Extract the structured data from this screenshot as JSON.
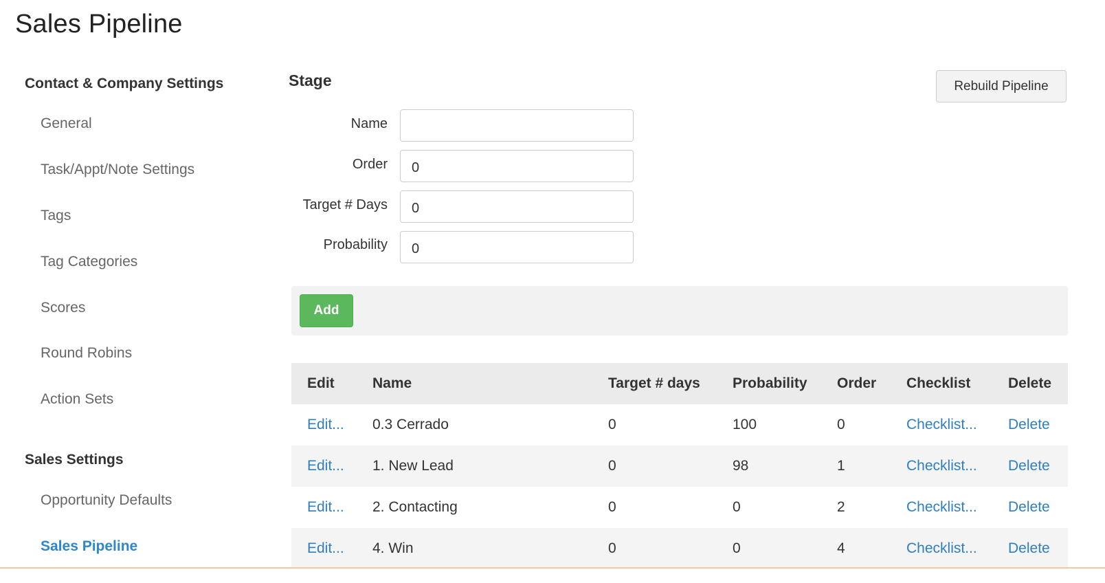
{
  "page": {
    "title": "Sales Pipeline"
  },
  "sidebar": {
    "contact_heading": "Contact & Company Settings",
    "contact_items": [
      {
        "label": "General"
      },
      {
        "label": "Task/Appt/Note Settings"
      },
      {
        "label": "Tags"
      },
      {
        "label": "Tag Categories"
      },
      {
        "label": "Scores"
      },
      {
        "label": "Round Robins"
      },
      {
        "label": "Action Sets"
      }
    ],
    "sales_heading": "Sales Settings",
    "sales_items": [
      {
        "label": "Opportunity Defaults"
      },
      {
        "label": "Sales Pipeline",
        "active": true
      }
    ]
  },
  "stage_form": {
    "heading": "Stage",
    "rebuild_label": "Rebuild Pipeline",
    "fields": {
      "name": {
        "label": "Name",
        "value": ""
      },
      "order": {
        "label": "Order",
        "value": "0"
      },
      "target_days": {
        "label": "Target # Days",
        "value": "0"
      },
      "probability": {
        "label": "Probability",
        "value": "0"
      }
    },
    "add_label": "Add"
  },
  "table": {
    "headers": {
      "edit": "Edit",
      "name": "Name",
      "target_days": "Target # days",
      "probability": "Probability",
      "order": "Order",
      "checklist": "Checklist",
      "delete": "Delete"
    },
    "rows": [
      {
        "edit": "Edit...",
        "name": "0.3 Cerrado",
        "target_days": "0",
        "probability": "100",
        "order": "0",
        "checklist": "Checklist...",
        "delete": "Delete"
      },
      {
        "edit": "Edit...",
        "name": "1. New Lead",
        "target_days": "0",
        "probability": "98",
        "order": "1",
        "checklist": "Checklist...",
        "delete": "Delete"
      },
      {
        "edit": "Edit...",
        "name": "2. Contacting",
        "target_days": "0",
        "probability": "0",
        "order": "2",
        "checklist": "Checklist...",
        "delete": "Delete"
      },
      {
        "edit": "Edit...",
        "name": "4. Win",
        "target_days": "0",
        "probability": "0",
        "order": "4",
        "checklist": "Checklist...",
        "delete": "Delete"
      }
    ]
  },
  "colors": {
    "link": "#2f7fbf",
    "active_nav": "#2f86c9",
    "add_button": "#5cb85c"
  }
}
